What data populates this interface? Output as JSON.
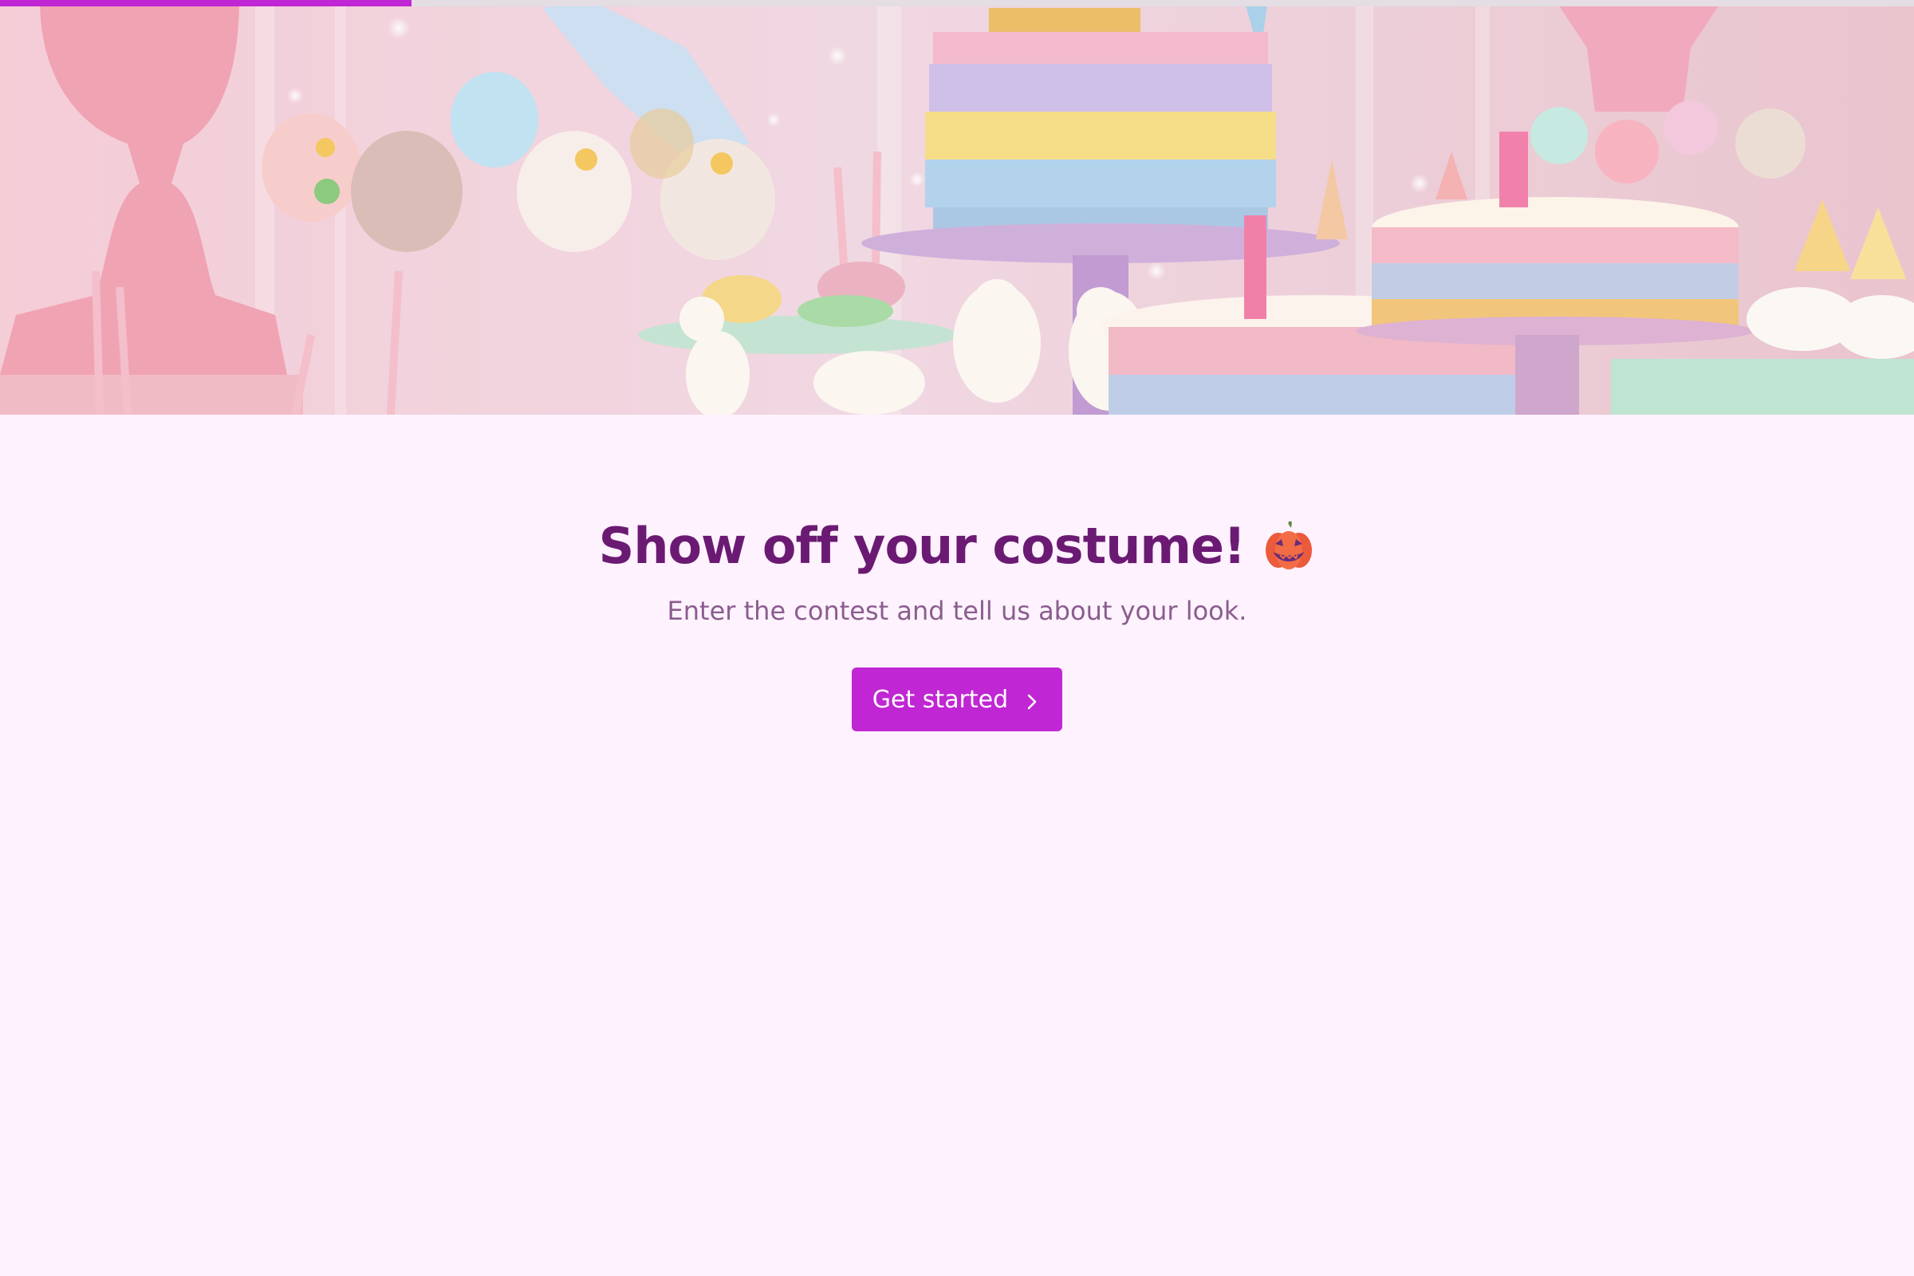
{
  "progress": {
    "fraction": 0.215
  },
  "hero": {
    "image_description": "Unicorn-themed party dessert table with pastel cakes"
  },
  "main": {
    "title": "Show off your costume!",
    "title_icon": "jack-o-lantern-icon",
    "subtitle": "Enter the contest and tell us about your look.",
    "cta_label": "Get started",
    "cta_icon": "chevron-right-icon"
  },
  "colors": {
    "accent": "#c026d3",
    "title": "#6b1a73",
    "subtitle": "#8a5d8e",
    "background": "#fdf2fd"
  }
}
